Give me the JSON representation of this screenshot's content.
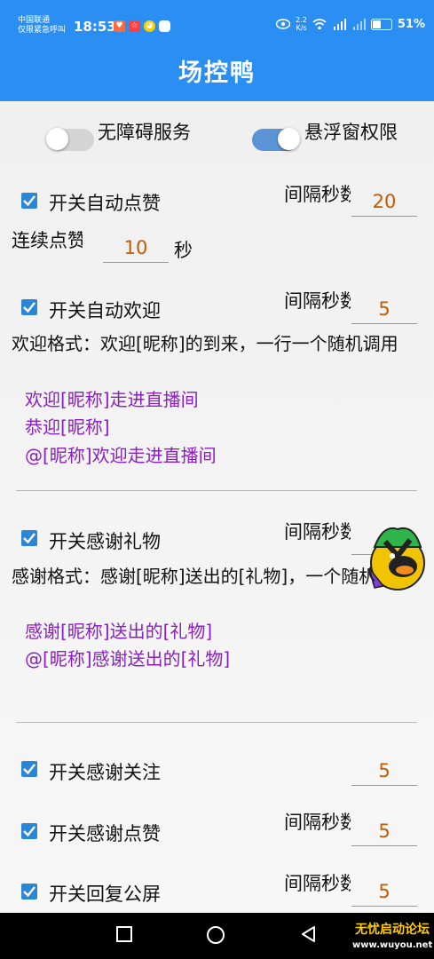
{
  "status_bar": {
    "carrier_line1": "中国联通",
    "carrier_line2": "仅限紧急呼叫",
    "time": "18:53",
    "speed_value": "2.2",
    "speed_unit": "K/s",
    "battery_percent": "51%",
    "battery_level": 0.51
  },
  "app": {
    "title": "场控鸭"
  },
  "toggles": {
    "accessibility": {
      "label": "无障碍服务",
      "on": false
    },
    "overlay": {
      "label": "悬浮窗权限",
      "on": true
    }
  },
  "auto_like": {
    "checkbox_label": "开关自动点赞",
    "interval_label": "间隔秒数：",
    "interval_value": "20",
    "count_label": "连续点赞：",
    "count_value": "10",
    "count_unit": "秒"
  },
  "auto_welcome": {
    "checkbox_label": "开关自动欢迎",
    "interval_label": "间隔秒数：",
    "interval_value": "5",
    "format_text": "欢迎格式：欢迎[昵称]的到来，一行一个随机调用",
    "templates": [
      "欢迎[昵称]走进直播间",
      "恭迎[昵称]",
      "@[昵称]欢迎走进直播间"
    ]
  },
  "thank_gift": {
    "checkbox_label": "开关感谢礼物",
    "interval_label": "间隔秒数：",
    "format_text": "感谢格式：感谢[昵称]送出的[礼物]，一个随机调用",
    "templates": [
      "感谢[昵称]送出的[礼物]",
      "@[昵称]感谢送出的[礼物]"
    ]
  },
  "thank_follow": {
    "checkbox_label": "开关感谢关注",
    "interval_value": "5"
  },
  "thank_like": {
    "checkbox_label": "开关感谢点赞",
    "interval_label": "间隔秒数：",
    "interval_value": "5"
  },
  "reply_public": {
    "checkbox_label": "开关回复公屏",
    "interval_label": "间隔秒数：",
    "interval_value": "5"
  },
  "watermark": {
    "title": "无忧启动论坛",
    "url": "www.wuyou.net"
  },
  "colors": {
    "primary": "#2a8ef2",
    "checkbox": "#2b86d8",
    "value": "#c55a00",
    "template": "#8a1fc0"
  }
}
